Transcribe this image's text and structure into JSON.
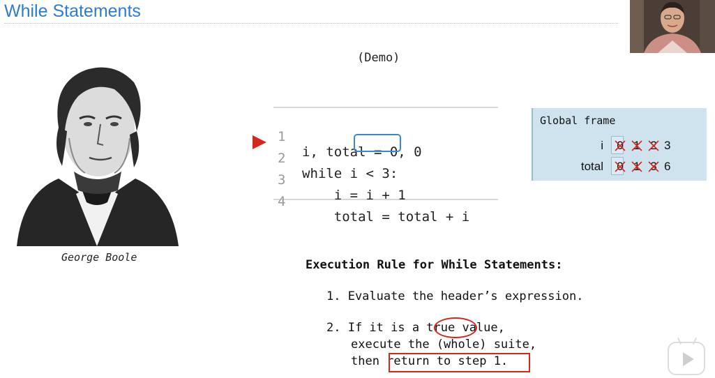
{
  "slide": {
    "title": "While Statements",
    "demo_label": "(Demo)"
  },
  "portrait": {
    "caption": "George Boole"
  },
  "code": {
    "lines": [
      {
        "number": "1",
        "text": "i, total = 0, 0"
      },
      {
        "number": "2",
        "text": "while i < 3:"
      },
      {
        "number": "3",
        "text": "    i = i + 1"
      },
      {
        "number": "4",
        "text": "    total = total + i"
      }
    ],
    "highlighted_condition": "i < 3",
    "current_line": "2"
  },
  "frame": {
    "title": "Global frame",
    "variables": [
      {
        "name": "i",
        "old_values": [
          "0",
          "1",
          "2"
        ],
        "current": "3"
      },
      {
        "name": "total",
        "old_values": [
          "0",
          "1",
          "3"
        ],
        "current": "6"
      }
    ]
  },
  "rule": {
    "title": "Execution Rule for While Statements:",
    "step1": "1. Evaluate the header’s expression.",
    "step2_line1": "2. If it is a true value,",
    "step2_line2": "execute the (whole) suite,",
    "step2_line3": "then return to step 1.",
    "circled_word": "true",
    "boxed_phrase": "return to step 1."
  },
  "colors": {
    "title": "#2e7bd6",
    "highlight_red": "#d7261e",
    "condition_box": "#3a88d8",
    "frame_bg": "#cfe3ef"
  },
  "icons": [
    "current-line-arrow-icon",
    "play-icon"
  ]
}
